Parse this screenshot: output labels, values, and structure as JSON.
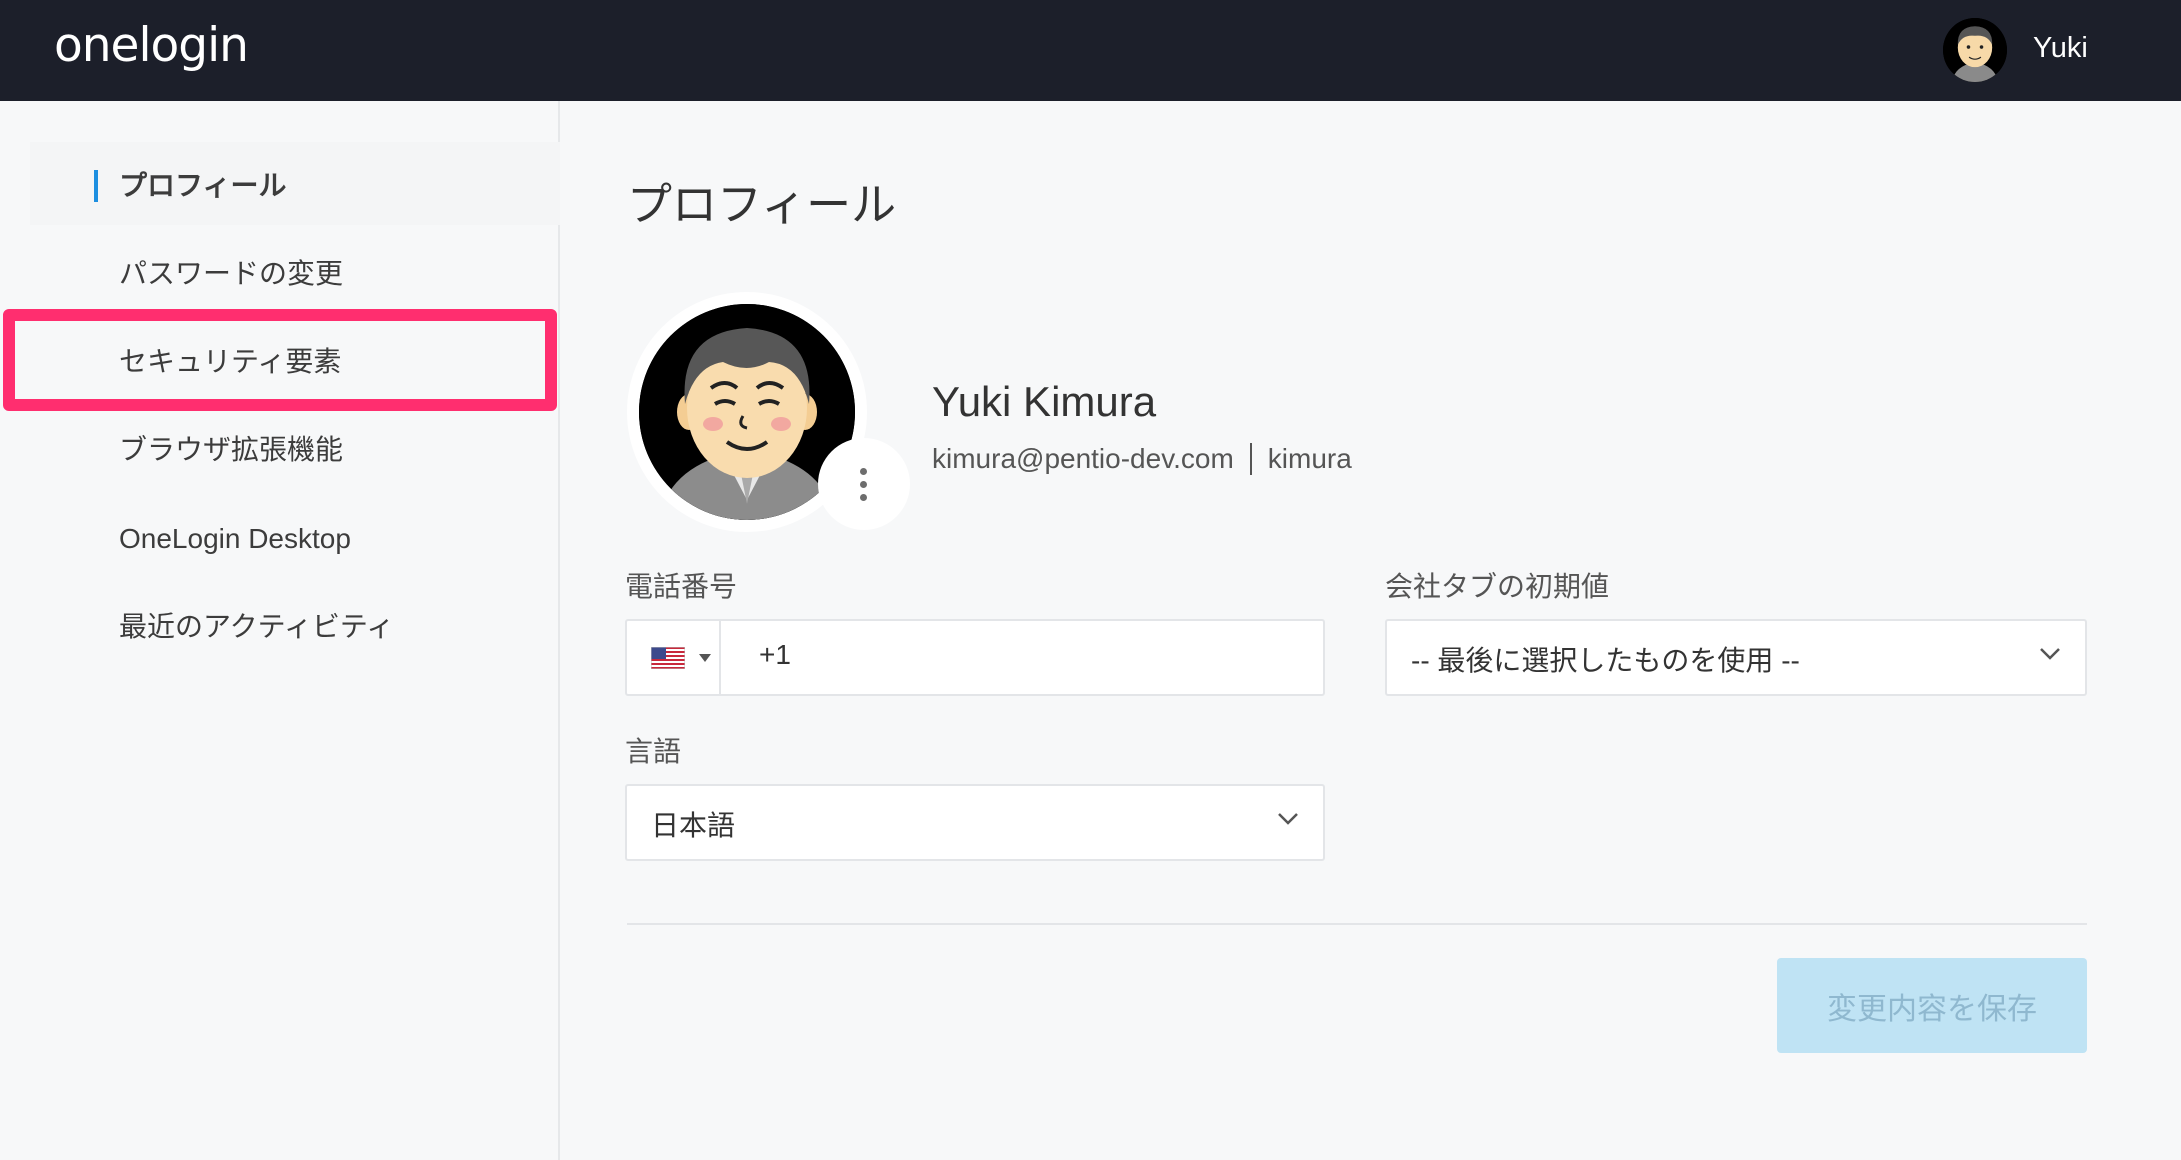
{
  "header": {
    "logo": "onelogin",
    "username": "Yuki"
  },
  "sidebar": {
    "items": [
      {
        "label": "プロフィール",
        "active": true
      },
      {
        "label": "パスワードの変更"
      },
      {
        "label": "セキュリティ要素",
        "highlighted": true
      },
      {
        "label": "ブラウザ拡張機能"
      },
      {
        "label": "OneLogin Desktop"
      },
      {
        "label": "最近のアクティビティ"
      }
    ],
    "active_indicator_color": "#1d8fe0",
    "highlight_color": "#ff2e6f"
  },
  "main": {
    "title": "プロフィール",
    "user": {
      "full_name": "Yuki Kimura",
      "email": "kimura@pentio-dev.com",
      "login": "kimura"
    },
    "phone": {
      "label": "電話番号",
      "country_icon": "us-flag-icon",
      "value": "+1"
    },
    "company_tab": {
      "label": "会社タブの初期値",
      "value": "-- 最後に選択したものを使用 --"
    },
    "language": {
      "label": "言語",
      "value": "日本語"
    },
    "save_button": {
      "label": "変更内容を保存",
      "disabled": true,
      "color": "#bfe3f4"
    }
  }
}
